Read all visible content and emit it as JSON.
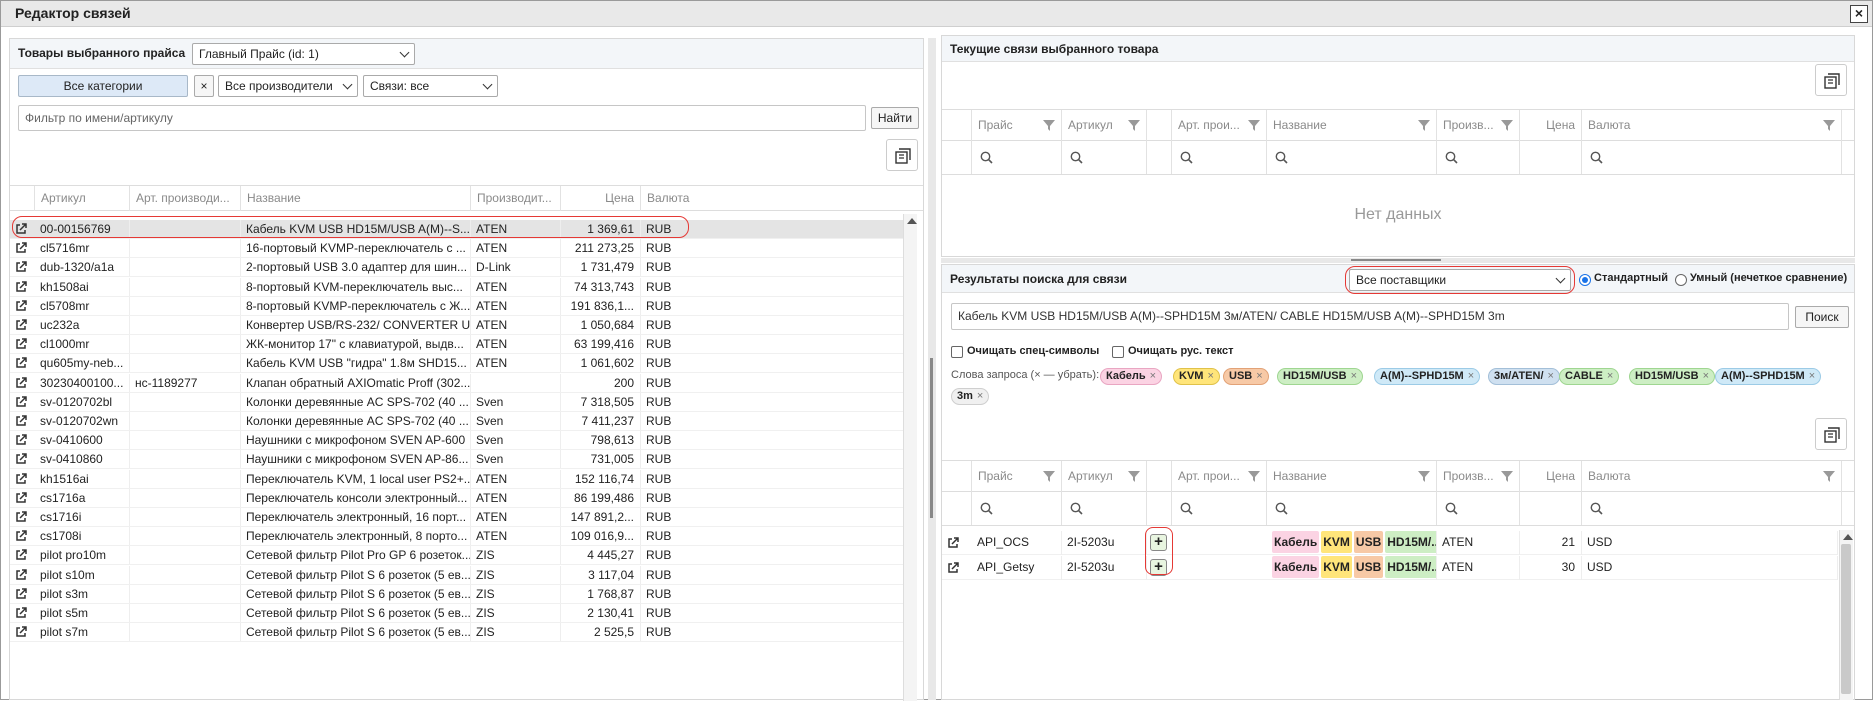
{
  "window": {
    "title": "Редактор связей",
    "close": "×"
  },
  "left": {
    "header": "Товары выбранного прайса",
    "price_select": "Главный Прайс (id: 1)",
    "categories_btn": "Все категории",
    "clear_btn": "×",
    "manufacturer_select": "Все производители",
    "links_select": "Связи: все",
    "filter_placeholder": "Фильтр по имени/артикулу",
    "find_btn": "Найти",
    "columns": [
      "Артикул",
      "Арт. производи...",
      "Название",
      "Производит...",
      "Цена",
      "Валюта"
    ],
    "rows": [
      [
        "00-00156769",
        "",
        "Кабель KVM USB HD15M/USB A(M)--S...",
        "ATEN",
        "1 369,61",
        "RUB"
      ],
      [
        "cl5716mr",
        "",
        "16-портовый KVMP-переключатель с ...",
        "ATEN",
        "211 273,25",
        "RUB"
      ],
      [
        "dub-1320/a1a",
        "",
        "2-портовый USB 3.0 адаптер для шин...",
        "D-Link",
        "1 731,479",
        "RUB"
      ],
      [
        "kh1508ai",
        "",
        "8-портовый KVM-переключатель выс...",
        "ATEN",
        "74 313,743",
        "RUB"
      ],
      [
        "cl5708mr",
        "",
        "8-портовый KVMP-переключатель с Ж...",
        "ATEN",
        "191 836,1...",
        "RUB"
      ],
      [
        "uc232a",
        "",
        "Конвертер USB/RS-232/ CONVERTER U...",
        "ATEN",
        "1 050,684",
        "RUB"
      ],
      [
        "cl1000mr",
        "",
        "ЖК-монитор 17\" с клавиатурой, выдв...",
        "ATEN",
        "63 199,416",
        "RUB"
      ],
      [
        "qu605my-neb...",
        "",
        "Кабель KVM USB \"гидра\" 1.8м SHD15...",
        "ATEN",
        "1 061,602",
        "RUB"
      ],
      [
        "30230400100...",
        "нс-1189277",
        "Клапан обратный AXIOmatic Proff (302...",
        "",
        "200",
        "RUB"
      ],
      [
        "sv-0120702bl",
        "",
        "Колонки деревянные AC SPS-702 (40 ...",
        "Sven",
        "7 318,505",
        "RUB"
      ],
      [
        "sv-0120702wn",
        "",
        "Колонки деревянные AC SPS-702 (40 ...",
        "Sven",
        "7 411,237",
        "RUB"
      ],
      [
        "sv-0410600",
        "",
        "Наушники с микрофоном SVEN AP-600",
        "Sven",
        "798,613",
        "RUB"
      ],
      [
        "sv-0410860",
        "",
        "Наушники с микрофоном SVEN AP-86...",
        "Sven",
        "731,005",
        "RUB"
      ],
      [
        "kh1516ai",
        "",
        "Переключатель KVM, 1 local user PS2+...",
        "ATEN",
        "152 116,74",
        "RUB"
      ],
      [
        "cs1716a",
        "",
        "Переключатель консоли электронный...",
        "ATEN",
        "86 199,486",
        "RUB"
      ],
      [
        "cs1716i",
        "",
        "Переключатель электронный, 16 порт...",
        "ATEN",
        "147 891,2...",
        "RUB"
      ],
      [
        "cs1708i",
        "",
        "Переключатель электронный, 8 порто...",
        "ATEN",
        "109 016,9...",
        "RUB"
      ],
      [
        "pilot pro10m",
        "",
        "Сетевой фильтр Pilot Pro GP 6 розеток...",
        "ZIS",
        "4 445,27",
        "RUB"
      ],
      [
        "pilot s10m",
        "",
        "Сетевой фильтр Pilot S 6 розеток (5 ев...",
        "ZIS",
        "3 117,04",
        "RUB"
      ],
      [
        "pilot s3m",
        "",
        "Сетевой фильтр Pilot S 6 розеток (5 ев...",
        "ZIS",
        "1 768,87",
        "RUB"
      ],
      [
        "pilot s5m",
        "",
        "Сетевой фильтр Pilot S 6 розеток (5 ев...",
        "ZIS",
        "2 130,41",
        "RUB"
      ],
      [
        "pilot s7m",
        "",
        "Сетевой фильтр Pilot S 6 розеток (5 ев...",
        "ZIS",
        "2 525,5",
        "RUB"
      ]
    ]
  },
  "right_top": {
    "header": "Текущие связи выбранного товара",
    "columns": [
      "Прайс",
      "Артикул",
      "",
      "Арт. прои...",
      "Название",
      "Произв...",
      "Цена",
      "Валюта"
    ],
    "no_data": "Нет данных"
  },
  "right_bottom": {
    "header": "Результаты поиска для связи",
    "supplier_select": "Все поставщики",
    "mode_standard": "Стандартный",
    "mode_smart": "Умный (нечеткое сравнение)",
    "query": "Кабель KVM USB HD15M/USB A(M)--SPHD15M 3м/ATEN/ CABLE HD15M/USB A(M)--SPHD15M 3m",
    "search_btn": "Поиск",
    "clear_special": "Очищать спец-символы",
    "clear_rus": "Очищать рус. текст",
    "words_label": "Слова запроса (× — убрать):",
    "chips": [
      "Кабель",
      "KVM",
      "USB",
      "HD15M/USB",
      "A(M)--SPHD15M",
      "3м/ATEN/",
      "CABLE",
      "HD15M/USB",
      "A(M)--SPHD15M",
      "3m"
    ],
    "chip_close": "×",
    "columns": [
      "Прайс",
      "Артикул",
      "",
      "Арт. прои...",
      "Название",
      "Произв...",
      "Цена",
      "Валюта"
    ],
    "rows": [
      {
        "price": "API_OCS",
        "article": "2I-5203u",
        "plus": "+",
        "name_tags": [
          "Кабель",
          "KVM",
          "USB",
          "HD15M/..."
        ],
        "maker": "ATEN",
        "price_val": "21",
        "currency": "USD"
      },
      {
        "price": "API_Getsy",
        "article": "2I-5203u",
        "plus": "+",
        "name_tags": [
          "Кабель",
          "KVM",
          "USB",
          "HD15M/..."
        ],
        "maker": "ATEN",
        "price_val": "30",
        "currency": "USD"
      }
    ]
  },
  "colors": {
    "accent": "#1a73e8",
    "highlight_ring": "#e53935",
    "selected_row": "#e4e4e4"
  }
}
